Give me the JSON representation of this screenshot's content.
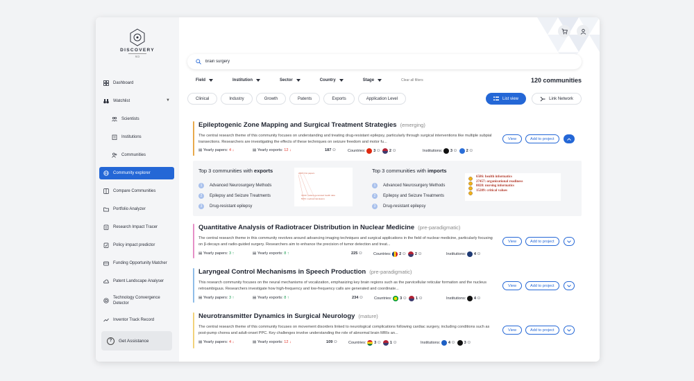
{
  "logo": {
    "name": "DISCOVERY",
    "sub": "SCI"
  },
  "sidebar": {
    "items": [
      {
        "label": "Dashboard"
      },
      {
        "label": "Watchlist"
      },
      {
        "label": "Scientists"
      },
      {
        "label": "Institutions"
      },
      {
        "label": "Communities"
      },
      {
        "label": "Community explorer"
      },
      {
        "label": "Compare Communities"
      },
      {
        "label": "Portfolio Analyzer"
      },
      {
        "label": "Research Impact Tracer"
      },
      {
        "label": "Policy impact predictor"
      },
      {
        "label": "Funding Opportunity Matcher"
      },
      {
        "label": "Patent Landscape Analyser"
      },
      {
        "label": "Technology Convergence Detector"
      },
      {
        "label": "Inventor Track Record"
      }
    ],
    "assist_label": "Get Assistance"
  },
  "search": {
    "value": "brain surgery"
  },
  "filters": {
    "field": "Field",
    "institution": "Institution",
    "sector": "Sector",
    "country": "Country",
    "stage": "Stage",
    "clear": "Clear all filters"
  },
  "result_count": "120 communities",
  "chips": [
    "Clinical",
    "Industry",
    "Growth",
    "Patents",
    "Exports",
    "Application Level"
  ],
  "view_buttons": {
    "list": "List view",
    "network": "Link Network"
  },
  "labels": {
    "yearly_papers": "Yearly papers:",
    "yearly_exports": "Yearly exports:",
    "countries": "Countries:",
    "institutions": "Institutions:",
    "view": "View",
    "add_to_project": "Add to project"
  },
  "communities": [
    {
      "title": "Epileptogenic Zone Mapping and Surgical Treatment Strategies",
      "stage": "(emerging)",
      "description": "The central research theme of this community focuses on understanding and treating drug-resistant epilepsy, particularly through surgical interventions like multiple subpial transections. Researchers are investigating the effects of these techniques on seizure freedom and motor fu...",
      "papers": "4",
      "exports": "12",
      "members": "187",
      "countries": [
        "3",
        "2"
      ],
      "institutions": [
        "3",
        "2"
      ]
    },
    {
      "title": "Quantitative Analysis of Radiotracer Distribution in Nuclear Medicine",
      "stage": "(pre-paradigmatic)",
      "description": "The central research theme in this community revolves around advancing imaging techniques and surgical applications in the field of nuclear medicine, particularly focusing on β-decays and radio-guided surgery. Researchers aim to enhance the precision of tumor detection and treat...",
      "papers": "3",
      "exports": "8",
      "members": "225",
      "countries": [
        "2",
        "2"
      ],
      "institutions": [
        "4"
      ]
    },
    {
      "title": "Laryngeal Control Mechanisms in Speech Production",
      "stage": "(pre-paradigmatic)",
      "description": "This research community focuses on the neural mechanisms of vocalization, emphasizing key brain regions such as the parvicellular reticular formation and the nucleus retroambiguus. Researchers investigate how high-frequency and low-frequency calls are generated and coordinate...",
      "papers": "3",
      "exports": "8",
      "members": "234",
      "countries": [
        "3",
        "1"
      ],
      "institutions": [
        "4"
      ]
    },
    {
      "title": "Neurotransmitter Dynamics in Surgical Neurology",
      "stage": "(mature)",
      "description": "The central research theme of this community focuses on movement disorders linked to neurological complications following cardiac surgery, including conditions such as post-pump chorea and adult-onset PPC. Key challenges involve understanding the role of abnormal brain MRIs an...",
      "papers": "4",
      "exports": "12",
      "members": "109",
      "countries": [
        "3",
        "1"
      ],
      "institutions": [
        "4",
        "3"
      ]
    }
  ],
  "expanded_panel": {
    "exports_title_pre": "Top 3 communities with",
    "exports_title_bold": "exports",
    "imports_title_pre": "Top 3 communities with",
    "imports_title_bold": "imports",
    "exports": [
      "Advanced Neurosurgery Methods",
      "Epilepsy and Seizure Treatments",
      "Drug-resistant epilepsy"
    ],
    "imports": [
      "Advanced Neurosurgery Methods",
      "Epilepsy and Seizure Treatments",
      "Drug-resistant epilepsy"
    ],
    "numbers": [
      "1",
      "2",
      "3"
    ],
    "exports_thumb": [
      "2394: first papers",
      "3110c: patient-generated health data",
      "5073: medical calculators"
    ],
    "imports_thumb": [
      "6586: health informatics",
      "27457: organizational readiness",
      "8828: nursing informatics",
      "15289: critical values"
    ]
  },
  "colors": {
    "accent": "#2467d6",
    "up": "#1e9e55",
    "down": "#e0362c"
  }
}
